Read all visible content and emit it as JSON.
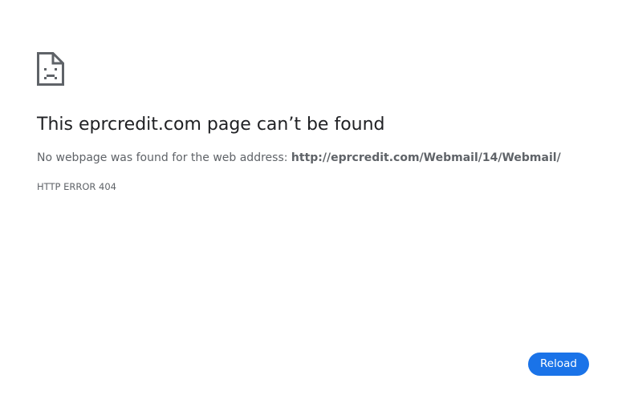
{
  "icon": "sad-page-icon",
  "title": "This eprcredit.com page can’t be found",
  "description": {
    "prefix": "No webpage was found for the web address: ",
    "url": "http://eprcredit.com/Webmail/14/Webmail/"
  },
  "error_code": "HTTP ERROR 404",
  "reload_label": "Reload",
  "colors": {
    "accent": "#1a73e8",
    "text": "#202124",
    "secondary_text": "#5f6368",
    "icon": "#5f6368"
  }
}
